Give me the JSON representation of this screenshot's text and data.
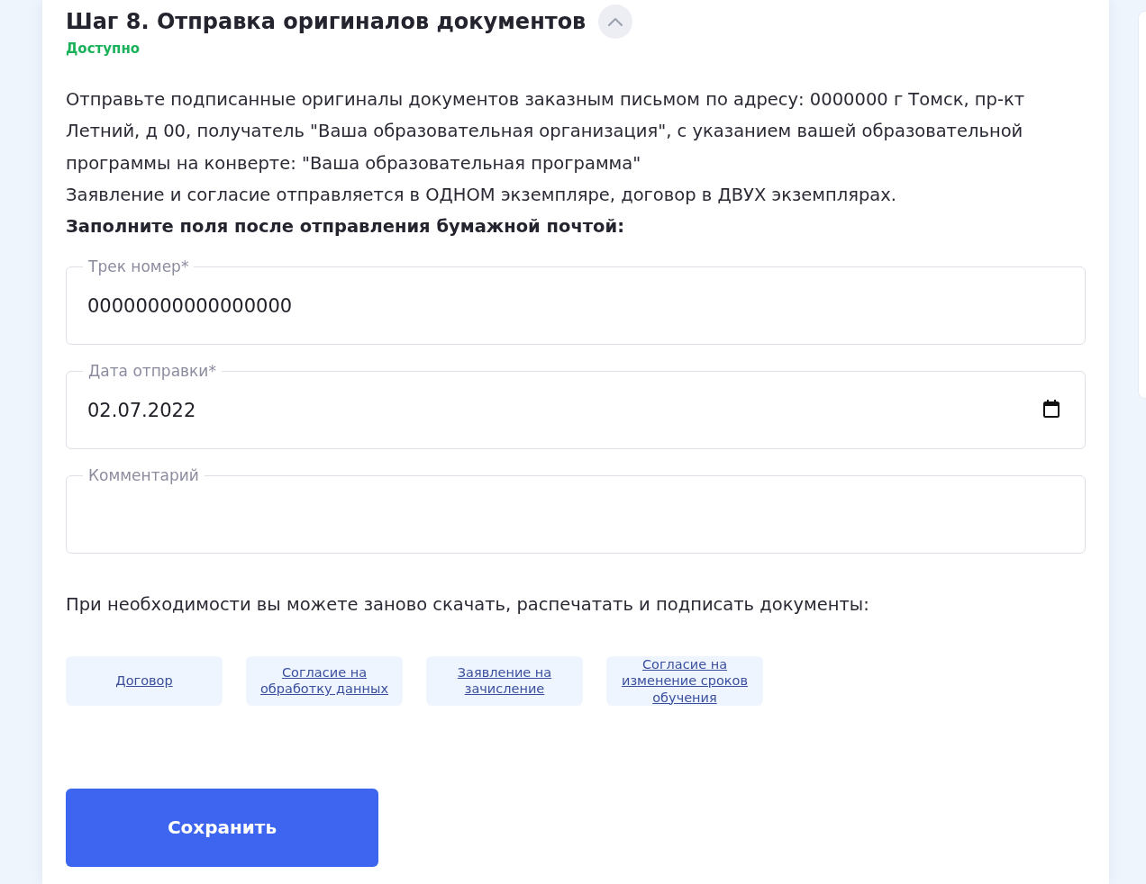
{
  "step": {
    "title": "Шаг 8. Отправка оригиналов документов",
    "expanded": true,
    "status": "Доступно"
  },
  "paragraphs": [
    {
      "text": "Отправьте подписанные оригиналы документов заказным письмом по адресу: 0000000 г Томск, пр-кт Летний, д 00, получатель \"Ваша образовательная организация\", с указанием вашей образовательной программы на конверте: \"Ваша образовательная программа\"",
      "bold": false
    },
    {
      "text": "Заявление и согласие отправляется в ОДНОМ экземпляре, договор в ДВУХ экземплярах.",
      "bold": false
    },
    {
      "text": "Заполните поля после отправления бумажной почтой:",
      "bold": true
    }
  ],
  "fields": [
    {
      "kind": "text",
      "label": "Трек номер*",
      "value": "00000000000000000"
    },
    {
      "kind": "date",
      "label": "Дата отправки*",
      "value": "02.07.2022"
    },
    {
      "kind": "textarea",
      "label": "Комментарий"
    }
  ],
  "documents_prompt": "При необходимости вы можете заново скачать, распечатать и подписать документы:",
  "documents": [
    {
      "label": "Договор"
    },
    {
      "label": "Согласие на обработку данных"
    },
    {
      "label": "Заявление на зачисление"
    },
    {
      "label": "Согласие на изменение сроков обучения"
    }
  ],
  "save_button": "Сохранить"
}
